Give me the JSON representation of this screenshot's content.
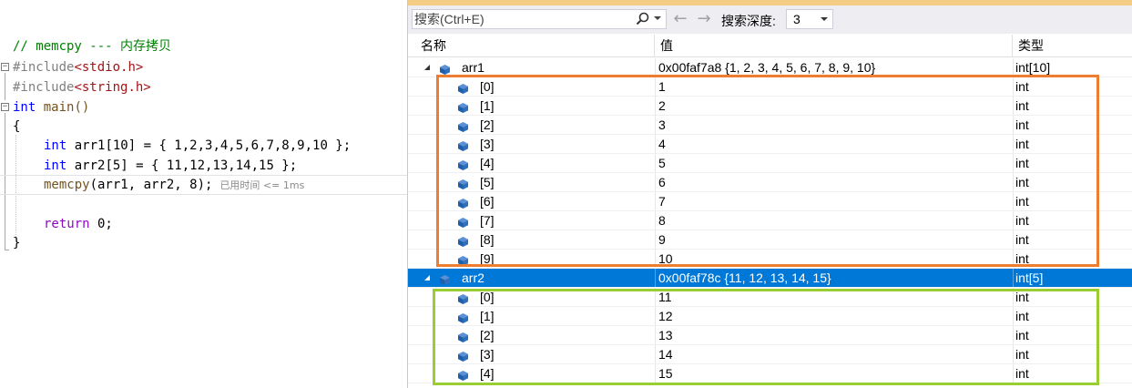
{
  "editor": {
    "comment": "// memcpy --- 内存拷贝",
    "include1": {
      "directive": "#include",
      "file": "<stdio.h>"
    },
    "include2": {
      "directive": "#include",
      "file": "<string.h>"
    },
    "main_kw": "int",
    "main_sig": " main()",
    "open_brace": "{",
    "decl1": {
      "kw": "int",
      "rest": " arr1[10] = { 1,2,3,4,5,6,7,8,9,10 };"
    },
    "decl2": {
      "kw": "int",
      "rest": " arr2[5] = { 11,12,13,14,15 };"
    },
    "call": {
      "fn": "memcpy",
      "rest": "(arr1, arr2, 8);",
      "perf_tip": "已用时间 <= 1ms"
    },
    "ret": {
      "kw": "return",
      "rest": " 0;"
    },
    "close_brace": "}"
  },
  "watch": {
    "search_placeholder": "搜索(Ctrl+E)",
    "back_arrow": "←",
    "forward_arrow": "→",
    "depth_label": "搜索深度:",
    "depth_value": "3",
    "columns": {
      "name": "名称",
      "value": "值",
      "type": "类型"
    },
    "arr1": {
      "name": "arr1",
      "value": "0x00faf7a8 {1, 2, 3, 4, 5, 6, 7, 8, 9, 10}",
      "type": "int[10]"
    },
    "arr1_items": [
      {
        "name": "[0]",
        "value": "1",
        "type": "int"
      },
      {
        "name": "[1]",
        "value": "2",
        "type": "int"
      },
      {
        "name": "[2]",
        "value": "3",
        "type": "int"
      },
      {
        "name": "[3]",
        "value": "4",
        "type": "int"
      },
      {
        "name": "[4]",
        "value": "5",
        "type": "int"
      },
      {
        "name": "[5]",
        "value": "6",
        "type": "int"
      },
      {
        "name": "[6]",
        "value": "7",
        "type": "int"
      },
      {
        "name": "[7]",
        "value": "8",
        "type": "int"
      },
      {
        "name": "[8]",
        "value": "9",
        "type": "int"
      },
      {
        "name": "[9]",
        "value": "10",
        "type": "int"
      }
    ],
    "arr2": {
      "name": "arr2",
      "value": "0x00faf78c {11, 12, 13, 14, 15}",
      "type": "int[5]"
    },
    "arr2_items": [
      {
        "name": "[0]",
        "value": "11",
        "type": "int"
      },
      {
        "name": "[1]",
        "value": "12",
        "type": "int"
      },
      {
        "name": "[2]",
        "value": "13",
        "type": "int"
      },
      {
        "name": "[3]",
        "value": "14",
        "type": "int"
      },
      {
        "name": "[4]",
        "value": "15",
        "type": "int"
      }
    ]
  },
  "colors": {
    "selection": "#0078d7",
    "arr1_highlight": "#ed7d31",
    "arr2_highlight": "#9acd32",
    "icon_blue": "#1f5fa8"
  }
}
